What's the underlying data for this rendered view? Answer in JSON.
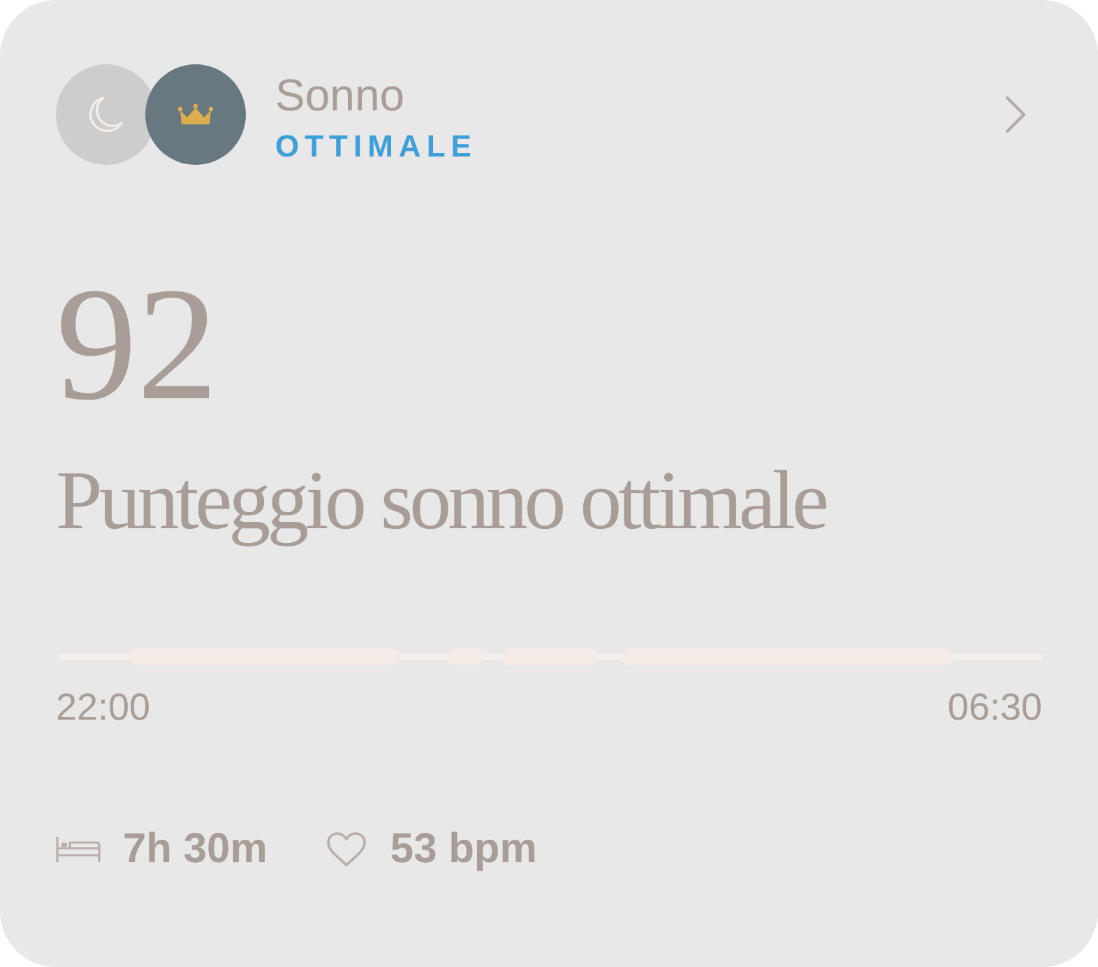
{
  "header": {
    "title": "Sonno",
    "status": "OTTIMALE"
  },
  "score": {
    "value": "92",
    "label": "Punteggio sonno ottimale"
  },
  "timeline": {
    "start": "22:00",
    "end": "06:30"
  },
  "stats": [
    {
      "kind": "duration",
      "value": "7h 30m"
    },
    {
      "kind": "heart_rate",
      "value": "53 bpm"
    }
  ]
}
